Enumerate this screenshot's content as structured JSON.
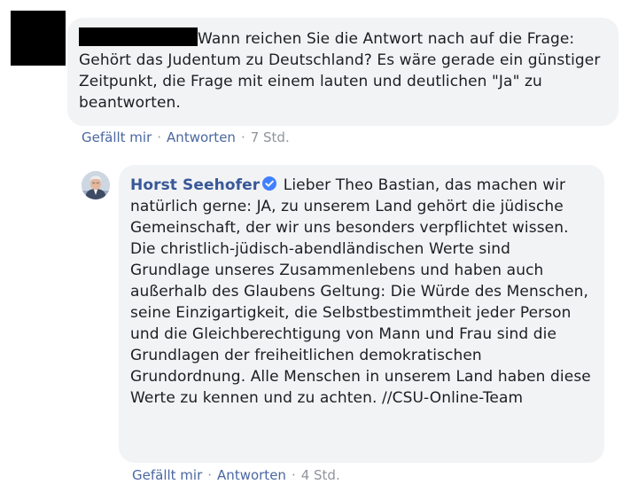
{
  "comment_1": {
    "text": "Wann reichen Sie die Antwort nach auf die Frage: Gehört das Judentum zu Deutschland? Es wäre gerade ein günstiger Zeitpunkt, die Frage mit einem lauten und deutlichen \"Ja\" zu beantworten.",
    "actions": {
      "like_label": "Gefällt mir",
      "reply_label": "Antworten",
      "separator": "·",
      "time": "7 Std."
    }
  },
  "reply_1": {
    "author": "Horst Seehofer",
    "verified_icon": "verified-badge-icon",
    "text": "Lieber Theo Bastian, das machen wir natürlich gerne: JA, zu unserem Land gehört die jüdische Gemeinschaft, der wir uns besonders verpflichtet wissen. Die christlich-jüdisch-abendländischen Werte sind Grundlage unseres Zusammenlebens und haben auch außerhalb des Glaubens Geltung: Die Würde des Menschen, seine Einzigartigkeit, die Selbstbestimmtheit jeder Person und die Gleichberechtigung von Mann und Frau sind die Grundlagen der freiheitlichen demokratischen Grundordnung. Alle Menschen in unserem Land haben diese Werte zu kennen und zu achten. //CSU-Online-Team",
    "actions": {
      "like_label": "Gefällt mir",
      "reply_label": "Antworten",
      "separator": "·",
      "time": "4 Std."
    }
  },
  "colors": {
    "bubble_bg": "#f2f3f5",
    "link": "#4a67a0",
    "author": "#385898",
    "meta": "#90949c",
    "verified": "#4080ff"
  }
}
